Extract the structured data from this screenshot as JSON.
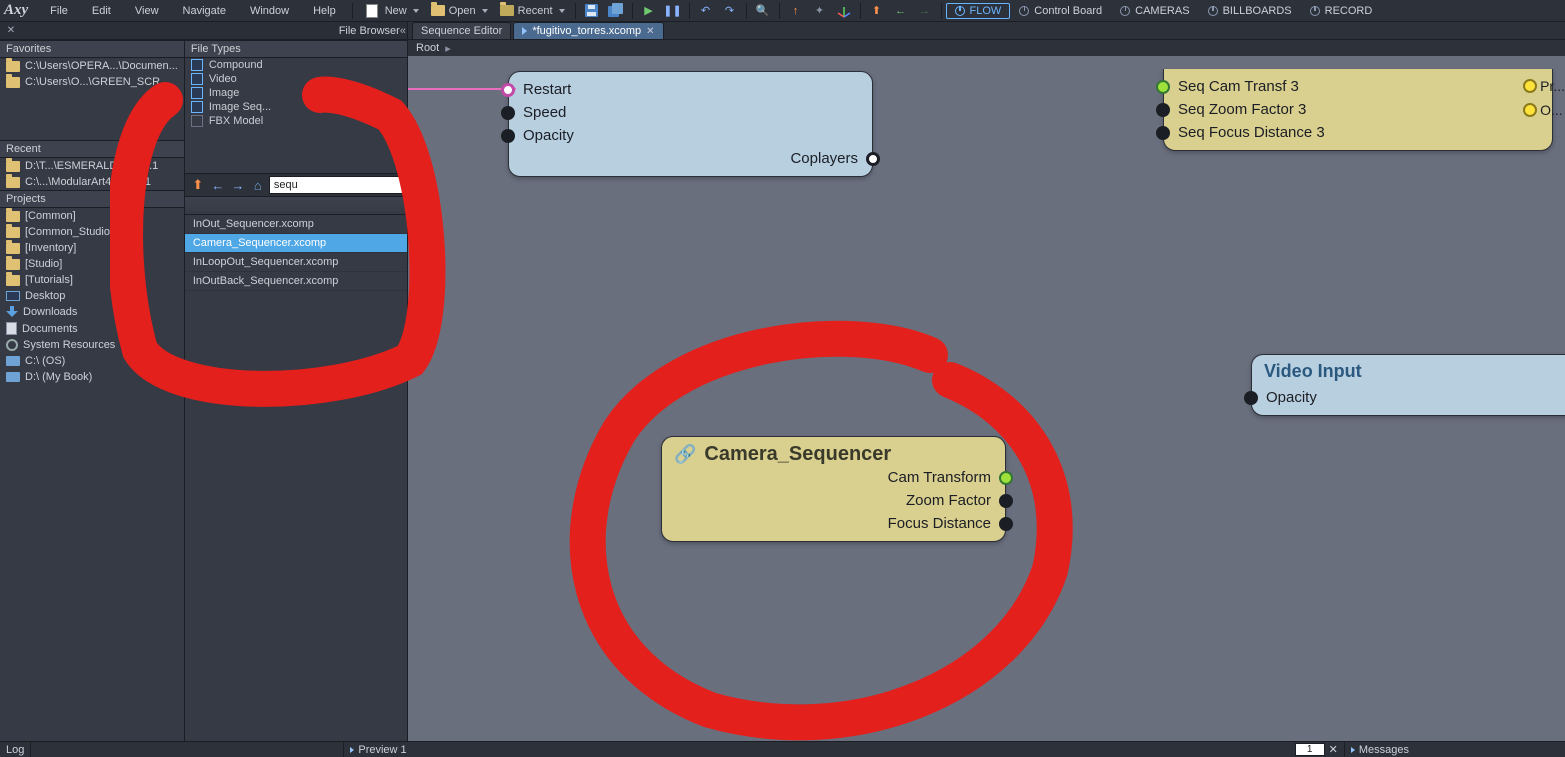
{
  "topMenu": {
    "logo": "Axy",
    "items": [
      "File",
      "Edit",
      "View",
      "Navigate",
      "Window",
      "Help"
    ],
    "new": "New",
    "open": "Open",
    "recent": "Recent",
    "powerButtons": [
      "FLOW",
      "Control Board",
      "CAMERAS",
      "BILLBOARDS",
      "RECORD"
    ],
    "activePower": "FLOW"
  },
  "fileBrowser": {
    "title": "File Browser",
    "favorites": {
      "header": "Favorites",
      "items": [
        "C:\\Users\\OPERA...\\Documen...",
        "C:\\Users\\O...\\GREEN_SCR..."
      ]
    },
    "recent": {
      "header": "Recent",
      "items": [
        "D:\\T...\\ESMERALDA_4_3.1",
        "C:\\...\\ModularArt4____5.1"
      ]
    },
    "projects": {
      "header": "Projects",
      "items": [
        {
          "label": "[Common]",
          "kind": "folder"
        },
        {
          "label": "[Common_Studio]",
          "kind": "folder"
        },
        {
          "label": "[Inventory]",
          "kind": "folder"
        },
        {
          "label": "[Studio]",
          "kind": "folder"
        },
        {
          "label": "[Tutorials]",
          "kind": "folder"
        },
        {
          "label": "Desktop",
          "kind": "monitor"
        },
        {
          "label": "Downloads",
          "kind": "download"
        },
        {
          "label": "Documents",
          "kind": "doc"
        },
        {
          "label": "System Resources",
          "kind": "gear"
        },
        {
          "label": "C:\\ (OS)",
          "kind": "drive"
        },
        {
          "label": "D:\\ (My Book)",
          "kind": "drive"
        }
      ]
    },
    "fileTypes": {
      "header": "File Types",
      "items": [
        {
          "label": "Compound",
          "checked": true
        },
        {
          "label": "Video",
          "checked": true
        },
        {
          "label": "Image",
          "checked": true
        },
        {
          "label": "Image Seq...",
          "checked": true
        },
        {
          "label": "FBX Model",
          "checked": false
        }
      ]
    },
    "search": {
      "value": "sequ"
    },
    "fileList": [
      {
        "name": "InOut_Sequencer.xcomp",
        "selected": false
      },
      {
        "name": "Camera_Sequencer.xcomp",
        "selected": true
      },
      {
        "name": "InLoopOut_Sequencer.xcomp",
        "selected": false
      },
      {
        "name": "InOutBack_Sequencer.xcomp",
        "selected": false
      }
    ]
  },
  "editor": {
    "tabs": [
      {
        "label": "Sequence Editor",
        "active": false,
        "dirty": false
      },
      {
        "label": "*fugitivo_torres.xcomp",
        "active": true,
        "dirty": true
      }
    ],
    "breadcrumb": [
      "Root"
    ],
    "nodes": {
      "topBlue": {
        "inputs": [
          "Restart",
          "Speed",
          "Opacity"
        ],
        "outputs": [
          "Coplayers"
        ]
      },
      "topTan": {
        "inputs": [
          "Seq Cam Transf 3",
          "Seq Zoom Factor 3",
          "Seq Focus Distance 3"
        ]
      },
      "camSeq": {
        "title": "Camera_Sequencer",
        "outputs": [
          "Cam Transform",
          "Zoom Factor",
          "Focus Distance"
        ]
      },
      "videoIn": {
        "title": "Video Input",
        "inputs": [
          "Opacity"
        ]
      }
    },
    "cornerPorts": [
      "Pr...",
      "O..."
    ]
  },
  "bottom": {
    "log": "Log",
    "preview": "Preview 1",
    "page": "1",
    "messages": "Messages"
  }
}
